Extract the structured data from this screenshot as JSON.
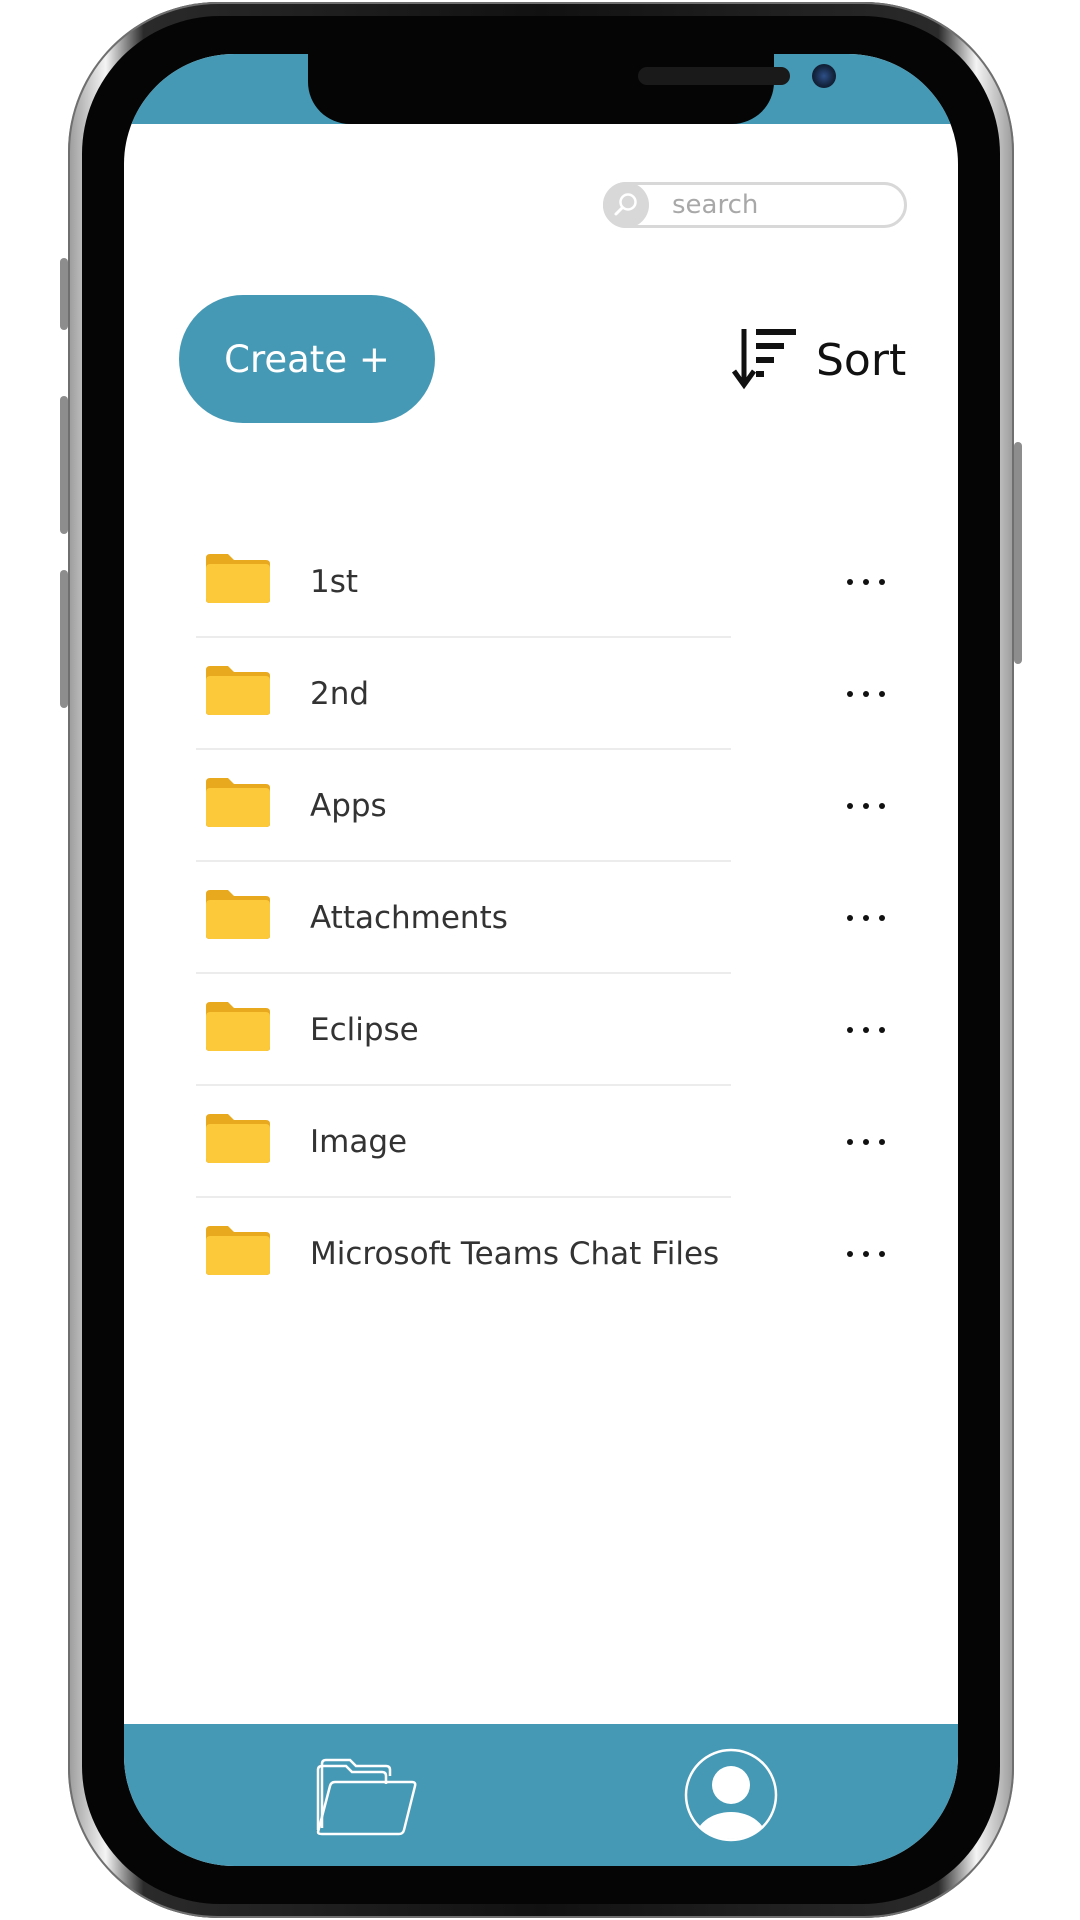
{
  "colors": {
    "accent": "#4699b5",
    "folder": "#f9c433",
    "text": "#333333"
  },
  "search": {
    "placeholder": "search",
    "value": ""
  },
  "toolbar": {
    "create_label": "Create +",
    "sort_label": "Sort"
  },
  "folders": [
    {
      "name": "1st",
      "icon": "folder-icon"
    },
    {
      "name": "2nd",
      "icon": "folder-icon"
    },
    {
      "name": "Apps",
      "icon": "folder-icon"
    },
    {
      "name": "Attachments",
      "icon": "folder-icon"
    },
    {
      "name": "Eclipse",
      "icon": "folder-icon"
    },
    {
      "name": "Image",
      "icon": "folder-icon"
    },
    {
      "name": "Microsoft Teams Chat Files",
      "icon": "folder-icon"
    }
  ],
  "bottom_nav": {
    "items": [
      {
        "icon": "folders-icon"
      },
      {
        "icon": "profile-icon"
      }
    ]
  }
}
